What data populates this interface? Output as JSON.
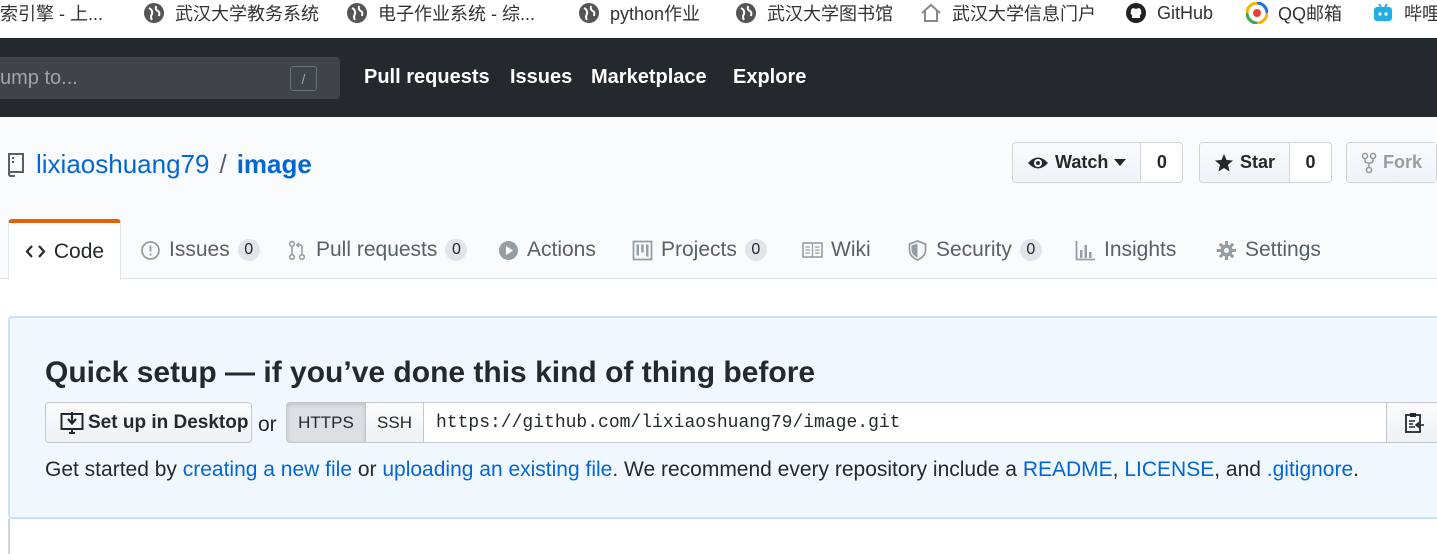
{
  "bookmarks": [
    {
      "label": "索引擎 - 上...",
      "icon": "none"
    },
    {
      "label": "武汉大学教务系统",
      "icon": "globe-icon"
    },
    {
      "label": "电子作业系统 - 综...",
      "icon": "globe-icon"
    },
    {
      "label": "python作业",
      "icon": "globe-icon"
    },
    {
      "label": "武汉大学图书馆",
      "icon": "globe-icon"
    },
    {
      "label": "武汉大学信息门户",
      "icon": "home-icon"
    },
    {
      "label": "GitHub",
      "icon": "github-icon"
    },
    {
      "label": "QQ邮箱",
      "icon": "qq-mail-icon"
    },
    {
      "label": "哔哩",
      "icon": "bilibili-icon"
    }
  ],
  "header": {
    "search_placeholder": "ump to...",
    "search_shortcut": "/",
    "nav": [
      "Pull requests",
      "Issues",
      "Marketplace",
      "Explore"
    ]
  },
  "repo": {
    "owner": "lixiaoshuang79",
    "separator": "/",
    "name": "image",
    "watch": {
      "label": "Watch",
      "count": "0"
    },
    "star": {
      "label": "Star",
      "count": "0"
    },
    "fork": {
      "label": "Fork"
    }
  },
  "tabs": [
    {
      "label": "Code",
      "icon": "code-icon",
      "selected": true
    },
    {
      "label": "Issues",
      "icon": "issue-icon",
      "count": "0"
    },
    {
      "label": "Pull requests",
      "icon": "pull-request-icon",
      "count": "0"
    },
    {
      "label": "Actions",
      "icon": "play-icon"
    },
    {
      "label": "Projects",
      "icon": "project-icon",
      "count": "0"
    },
    {
      "label": "Wiki",
      "icon": "book-icon"
    },
    {
      "label": "Security",
      "icon": "shield-icon",
      "count": "0"
    },
    {
      "label": "Insights",
      "icon": "graph-icon"
    },
    {
      "label": "Settings",
      "icon": "gear-icon"
    }
  ],
  "quick_setup": {
    "title": "Quick setup — if you’ve done this kind of thing before",
    "desktop_button": "Set up in Desktop",
    "or": "or",
    "https": "HTTPS",
    "ssh": "SSH",
    "clone_url": "https://github.com/lixiaoshuang79/image.git",
    "help": {
      "t1": "Get started by ",
      "link1": "creating a new file",
      "t2": " or ",
      "link2": "uploading an existing file",
      "t3": ". We recommend every repository include a ",
      "link3": "README",
      "t4": ", ",
      "link4": "LICENSE",
      "t5": ", and ",
      "link5": ".gitignore",
      "t6": "."
    }
  },
  "colors": {
    "header_bg": "#24292e",
    "link": "#0366d6",
    "tab_accent": "#e36209",
    "quick_bg": "#f1f8ff"
  }
}
